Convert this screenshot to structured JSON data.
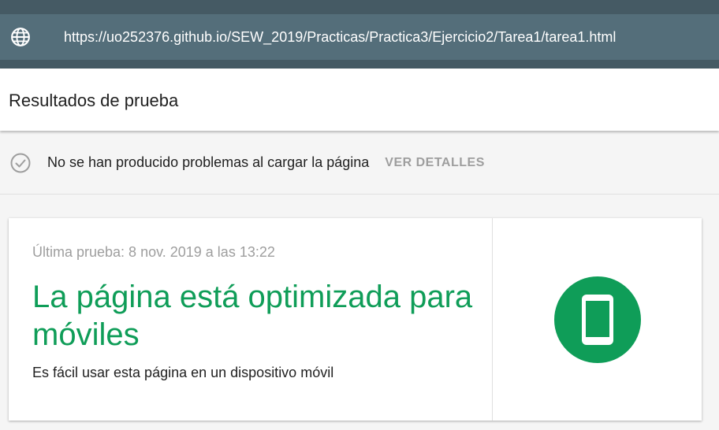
{
  "browser": {
    "url": "https://uo252376.github.io/SEW_2019/Practicas/Practica3/Ejercicio2/Tarea1/tarea1.html",
    "icon": "globe-icon"
  },
  "header": {
    "title": "Resultados de prueba"
  },
  "status": {
    "icon": "check-circle-icon",
    "message": "No se han producido problemas al cargar la página",
    "details_label": "VER DETALLES"
  },
  "result": {
    "last_test": "Última prueba: 8 nov. 2019 a las 13:22",
    "headline": "La página está optimizada para móviles",
    "description": "Es fácil usar esta página en un dispositivo móvil",
    "icon": "mobile-phone-icon",
    "accent_color": "#0f9d58"
  }
}
